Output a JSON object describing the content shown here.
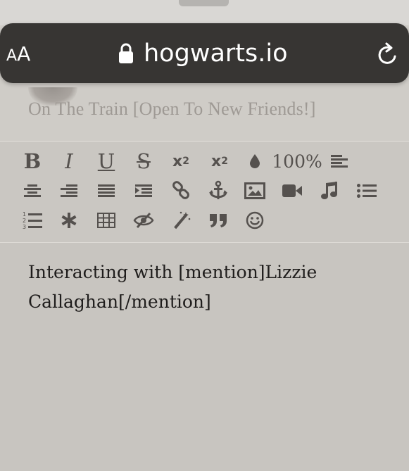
{
  "browser": {
    "text_size_label_small": "A",
    "text_size_label_large": "A",
    "url": "hogwarts.io"
  },
  "thread": {
    "title": "On The Train [Open To New Friends!]"
  },
  "toolbar": {
    "bold_label": "B",
    "italic_label": "I",
    "underline_label": "U",
    "strike_label": "S",
    "subscript_base": "x",
    "subscript_index": "2",
    "superscript_base": "x",
    "superscript_index": "2",
    "font_size_label": "100%"
  },
  "editor": {
    "content": "Interacting with [mention]Lizzie Callaghan[/mention]"
  },
  "colors": {
    "url_bar": "#373533",
    "toolbar_icon": "#55514e",
    "editor_background": "#c8c5c0",
    "editor_text": "#1f1d1c"
  }
}
